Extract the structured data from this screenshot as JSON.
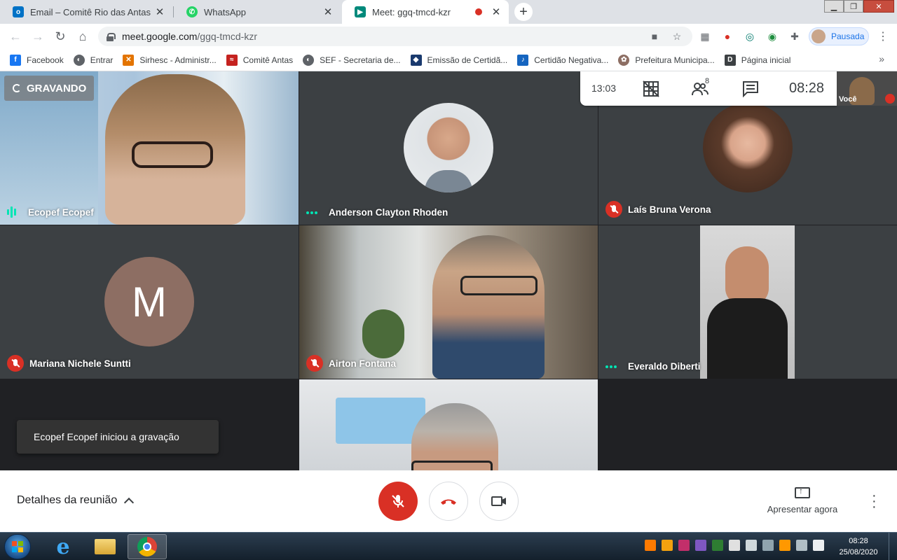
{
  "browser": {
    "tabs": [
      {
        "label": "Email – Comitê Rio das Antas e B",
        "icon": "outlook-icon",
        "color": "#0072c6"
      },
      {
        "label": "WhatsApp",
        "icon": "whatsapp-icon",
        "color": "#25d366"
      },
      {
        "label": "Meet: ggq-tmcd-kzr",
        "icon": "meet-icon",
        "color": "#00897b",
        "active": true
      }
    ],
    "new_tab": "+",
    "url_host": "meet.google.com",
    "url_path": "/ggq-tmcd-kzr",
    "profile_label": "Pausada",
    "bookmarks": [
      {
        "label": "Facebook",
        "icon": "facebook-icon",
        "color": "#1877f2"
      },
      {
        "label": "Entrar",
        "icon": "globe-icon",
        "color": "#5f6368"
      },
      {
        "label": "Sirhesc - Administr...",
        "icon": "sirhesc-icon",
        "color": "#e37400"
      },
      {
        "label": "Comitê Antas",
        "icon": "comite-icon",
        "color": "#c5221f"
      },
      {
        "label": "SEF - Secretaria de...",
        "icon": "globe-icon",
        "color": "#5f6368"
      },
      {
        "label": "Emissão de Certidã...",
        "icon": "certidao-icon",
        "color": "#1a3a6e"
      },
      {
        "label": "Certidão Negativa...",
        "icon": "runner-icon",
        "color": "#1565c0"
      },
      {
        "label": "Prefeitura Municipa...",
        "icon": "prefeitura-icon",
        "color": "#8d6e63"
      },
      {
        "label": "Página inicial",
        "icon": "d-icon",
        "color": "#3c4043"
      }
    ]
  },
  "meet": {
    "recording_label": "GRAVANDO",
    "elapsed": "13:03",
    "participants_count": "8",
    "clock": "08:28",
    "self_label": "Você",
    "participants": [
      {
        "name": "Ecopef Ecopef",
        "status": "speaking"
      },
      {
        "name": "Anderson Clayton Rhoden",
        "status": "more"
      },
      {
        "name": "Laís Bruna Verona",
        "status": "muted"
      },
      {
        "name": "Mariana Nichele Suntti",
        "status": "muted",
        "initial": "M",
        "avatar_color": "#8d6e63"
      },
      {
        "name": "Airton Fontana",
        "status": "muted"
      },
      {
        "name": "Everaldo Diberti",
        "status": "more"
      }
    ],
    "toast": "Ecopef Ecopef iniciou a gravação",
    "details_label": "Detalhes da reunião",
    "present_label": "Apresentar agora"
  },
  "taskbar": {
    "time": "08:28",
    "date": "25/08/2020"
  }
}
